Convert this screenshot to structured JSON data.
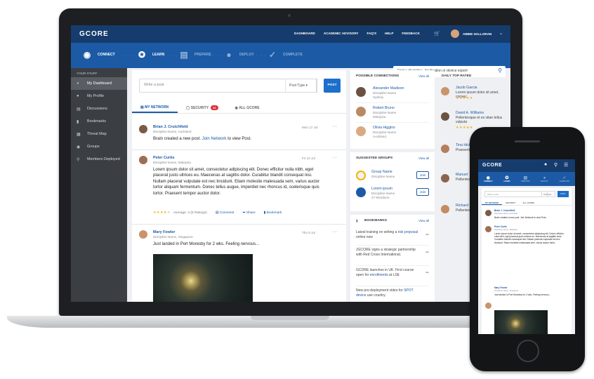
{
  "app": {
    "logo": "GCORE"
  },
  "topnav": {
    "items": [
      "DASHBOARD",
      "ACADEMIC ADVISORY",
      "FAQ'S",
      "HELP",
      "FEEDBACK"
    ],
    "user": "ABBIE HALLORAN"
  },
  "steps": [
    {
      "label": "CONNECT",
      "icon": "connect-icon"
    },
    {
      "label": "LEARN",
      "icon": "lightbulb-icon"
    },
    {
      "label": "PREPARE",
      "icon": "clipboard-icon"
    },
    {
      "label": "DEPLOY",
      "icon": "location-icon"
    },
    {
      "label": "COMPLETE",
      "icon": "check-icon"
    }
  ],
  "search": {
    "placeholder": "Find a discipline, destination or device expert"
  },
  "sidebar": {
    "title": "YOUR STUFF",
    "items": [
      {
        "label": "My Dashboard",
        "icon": "dashboard-icon"
      },
      {
        "label": "My Profile",
        "icon": "user-icon"
      },
      {
        "label": "Discussions",
        "icon": "chat-icon"
      },
      {
        "label": "Bookmarks",
        "icon": "bookmark-icon"
      },
      {
        "label": "Threat Map",
        "icon": "map-icon"
      },
      {
        "label": "Groups",
        "icon": "group-icon"
      },
      {
        "label": "Members Deployed",
        "icon": "pin-icon"
      }
    ]
  },
  "composer": {
    "placeholder": "Write a post",
    "post_type": "Post Type",
    "post_button": "POST"
  },
  "tabs": {
    "network": "MY NETWORK",
    "security": "SECURITY",
    "security_count": "12",
    "all": "ALL GCORE"
  },
  "posts": [
    {
      "name": "Brian J. Crutchfield",
      "sub": "Discipline Name, Auckland",
      "date": "Mon 17 Jul",
      "text_a": "Brain created a new post. ",
      "link": "Join Network",
      "text_b": " to view Post."
    },
    {
      "name": "Peter Curtis",
      "sub": "Discipline Name, Malaysia",
      "date": "Fri 12 Jul",
      "text": "Lorem ipsum dolor sit amet, consectetur adipiscing elit. Donec efficitur nulla nibh, eget placerat justo ultrices eu. Maecenas at sagittis dolor. Curabitur blandit consequat nisi. Nullam placerat vulputate est nec tincidunt. Etiam molestie malesuada sem, varius auctor tortor aliquam fermentum. Donec tellus augue, imperdiet nec rhoncus id, scelerisque quis tortor. Praesent tempor auctor dolor.",
      "rating": "Average: 4 (6 Ratings)",
      "comment": "Comment",
      "share": "Share",
      "bookmark": "Bookmark"
    },
    {
      "name": "Mary Fowler",
      "sub": "Discipline Name, Singapore",
      "date": "Thu 5 Jul",
      "text": "Just landed in Port Moresby for 2 wks. Feeling nervous..."
    }
  ],
  "connections": {
    "title": "POSSIBLE CONNECTIONS",
    "view_all": "View all",
    "items": [
      {
        "name": "Alexander Madison",
        "l1": "Discipline Name",
        "l2": "Sydney"
      },
      {
        "name": "Robert Bruno",
        "l1": "Discipline Name",
        "l2": "Malaysia"
      },
      {
        "name": "Olivia Higgins",
        "l1": "Discipline Name",
        "l2": "Auckland"
      }
    ]
  },
  "groups": {
    "title": "SUGGESTED GROUPS",
    "view_all": "View all",
    "join": "Join",
    "items": [
      {
        "name": "Group Name",
        "l1": "Discipline Name",
        "l2": ""
      },
      {
        "name": "Lorem ipsum",
        "l1": "Discipline Name",
        "l2": "47 Members"
      }
    ]
  },
  "bookmarks": {
    "title": "BOOKMARKS",
    "view_all": "View all",
    "items": [
      {
        "a": "Latest training on writing a ",
        "link": "risk proposal",
        "b": " online now"
      },
      {
        "a": "JGCORE signs a strategic partnership with Red Cross International.",
        "link": "",
        "b": ""
      },
      {
        "a": "GCORE launches in UK. First course open for ",
        "link": "enrollments",
        "b": " at LSE"
      },
      {
        "a": "New pre-deployment video for ",
        "link": "SPOT device",
        "b": " use country."
      }
    ]
  },
  "top_rated": {
    "title": "DAILY TOP RATED",
    "items": [
      {
        "name": "Jacob Garcia",
        "text": "Lorem ipsum dolor sit amet, consec"
      },
      {
        "name": "David A. Williams",
        "text": "Pellentesque et ex vitae tellus vulputa"
      },
      {
        "name": "Tina Hicki",
        "text": "Praesent hendrerit sed, pos"
      },
      {
        "name": "Manuel",
        "text": "Pellentesque vel vehic"
      },
      {
        "name": "Richard",
        "text": "Pellentesque"
      }
    ]
  },
  "phone": {
    "steps": [
      "CONNECT",
      "LEARN",
      "PREPARE",
      "DEPLOY",
      "COMPLETE"
    ],
    "composer": "Write a post",
    "post_type": "Post Type",
    "post_button": "POST",
    "tabs": [
      "MY NETWORK",
      "SECURITY",
      "ALL GCORE"
    ],
    "posts": [
      {
        "name": "Brian J. Crutchfield",
        "sub": "Discipline Name, Auckland",
        "text": "Brain created a new post. Join Network to view Post."
      },
      {
        "name": "Peter Curtis",
        "sub": "Discipline Name, Malaysia",
        "text": "Lorem ipsum dolor sit amet, consectetur adipiscing elit. Donec efficitur nulla nibh, eget placerat justo ultrices eu. Maecenas at sagittis dolor. Curabitur blandit consequat nisi. Nullam placerat vulputate est nec tincidunt. Etiam molestie malesuada sem, varius auctor tortor."
      },
      {
        "name": "Mary Fowler",
        "sub": "Discipline Name, Singapore",
        "text": "Just landed in Port Moresby for 2 wks. Feeling nervous..."
      }
    ]
  },
  "colors": {
    "nav": "#163c6d",
    "accent": "#1c5aa6",
    "sidebar": "#3b3e43"
  }
}
